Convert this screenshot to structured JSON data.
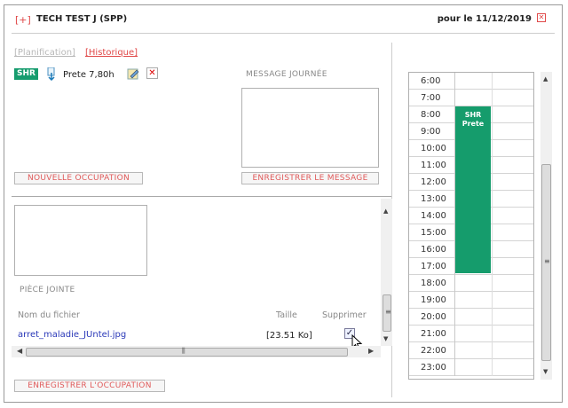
{
  "header": {
    "expand_label": "[+]",
    "title": "TECH TEST J (SPP)",
    "date_label": "pour le 11/12/2019",
    "close_icon": "close-icon"
  },
  "links": {
    "planification": "[Planification]",
    "historique": "[Historique]"
  },
  "occupation": {
    "badge": "SHR",
    "status": "Prete 7,80h",
    "badge_color": "#169c6e"
  },
  "message": {
    "label": "MESSAGE JOURNÉE",
    "value": "",
    "save_button": "ENREGISTRER LE MESSAGE"
  },
  "buttons": {
    "new_occupation": "NOUVELLE OCCUPATION",
    "save_occupation": "ENREGISTRER L'OCCUPATION"
  },
  "attachments": {
    "section_label": "PIÈCE JOINTE",
    "columns": [
      "Nom du fichier",
      "Taille",
      "Supprimer"
    ],
    "files": [
      {
        "name": "arret_maladie_JUntel.jpg",
        "size": "[23.51 Ko]",
        "delete_checked": true
      }
    ]
  },
  "calendar": {
    "hours": [
      "6:00",
      "7:00",
      "8:00",
      "9:00",
      "10:00",
      "11:00",
      "12:00",
      "13:00",
      "14:00",
      "15:00",
      "16:00",
      "17:00",
      "18:00",
      "19:00",
      "20:00",
      "21:00",
      "22:00",
      "23:00"
    ],
    "event": {
      "line1": "SHR",
      "line2": "Prete",
      "start": "8:00",
      "end": "18:00",
      "color": "#159c6c"
    }
  },
  "colors": {
    "accent": "#e04848",
    "link": "#2a38b8"
  }
}
